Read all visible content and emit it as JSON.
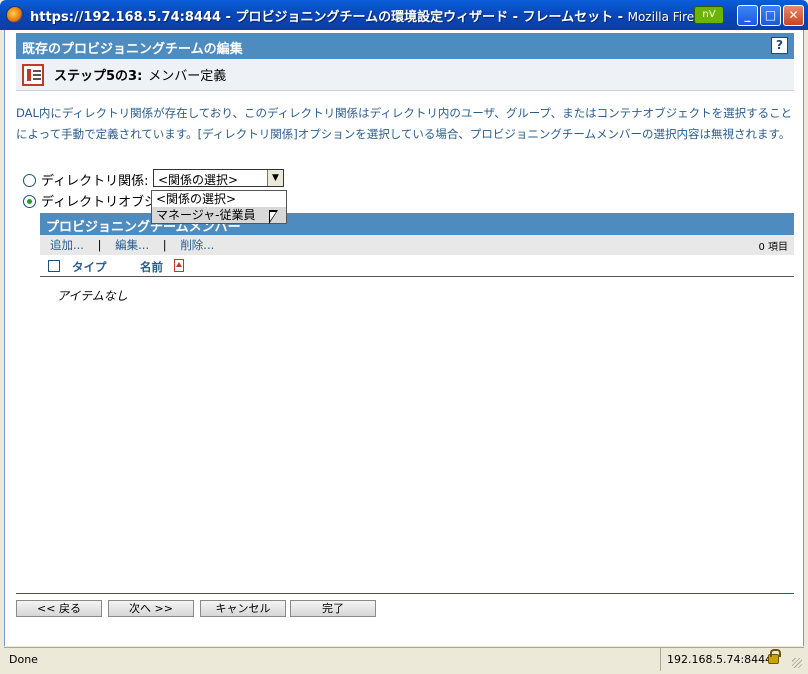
{
  "window": {
    "title": "https://192.168.5.74:8444 - プロビジョニングチームの環境設定ウィザード - フレームセット",
    "app": "Mozilla Firefox",
    "nv_badge": "nV"
  },
  "header": {
    "title": "既存のプロビジョニングチームの編集",
    "help": "?"
  },
  "step": {
    "label": "ステップ5の3:",
    "name": "メンバー定義"
  },
  "description": "DAL内にディレクトリ関係が存在しており、このディレクトリ関係はディレクトリ内のユーザ、グループ、またはコンテナオブジェクトを選択することによって手動で定義されています。[ディレクトリ関係]オプションを選択している場合、プロビジョニングチームメンバーの選択内容は無視されます。",
  "options": {
    "relationship_label": "ディレクトリ関係:",
    "objects_label": "ディレクトリオブジェ",
    "select_value": "<関係の選択>",
    "dropdown_options": [
      "<関係の選択>",
      "マネージャ-従業員"
    ]
  },
  "members": {
    "title": "プロビジョニングチームメンバー",
    "add": "追加...",
    "edit": "編集...",
    "delete": "削除...",
    "separator": "|",
    "count": "0 項目",
    "col_type": "タイプ",
    "col_name": "名前",
    "empty": "アイテムなし"
  },
  "buttons": {
    "back": "<< 戻る",
    "next": "次へ >>",
    "cancel": "キャンセル",
    "finish": "完了"
  },
  "status": {
    "text": "Done",
    "host": "192.168.5.74:8444"
  }
}
